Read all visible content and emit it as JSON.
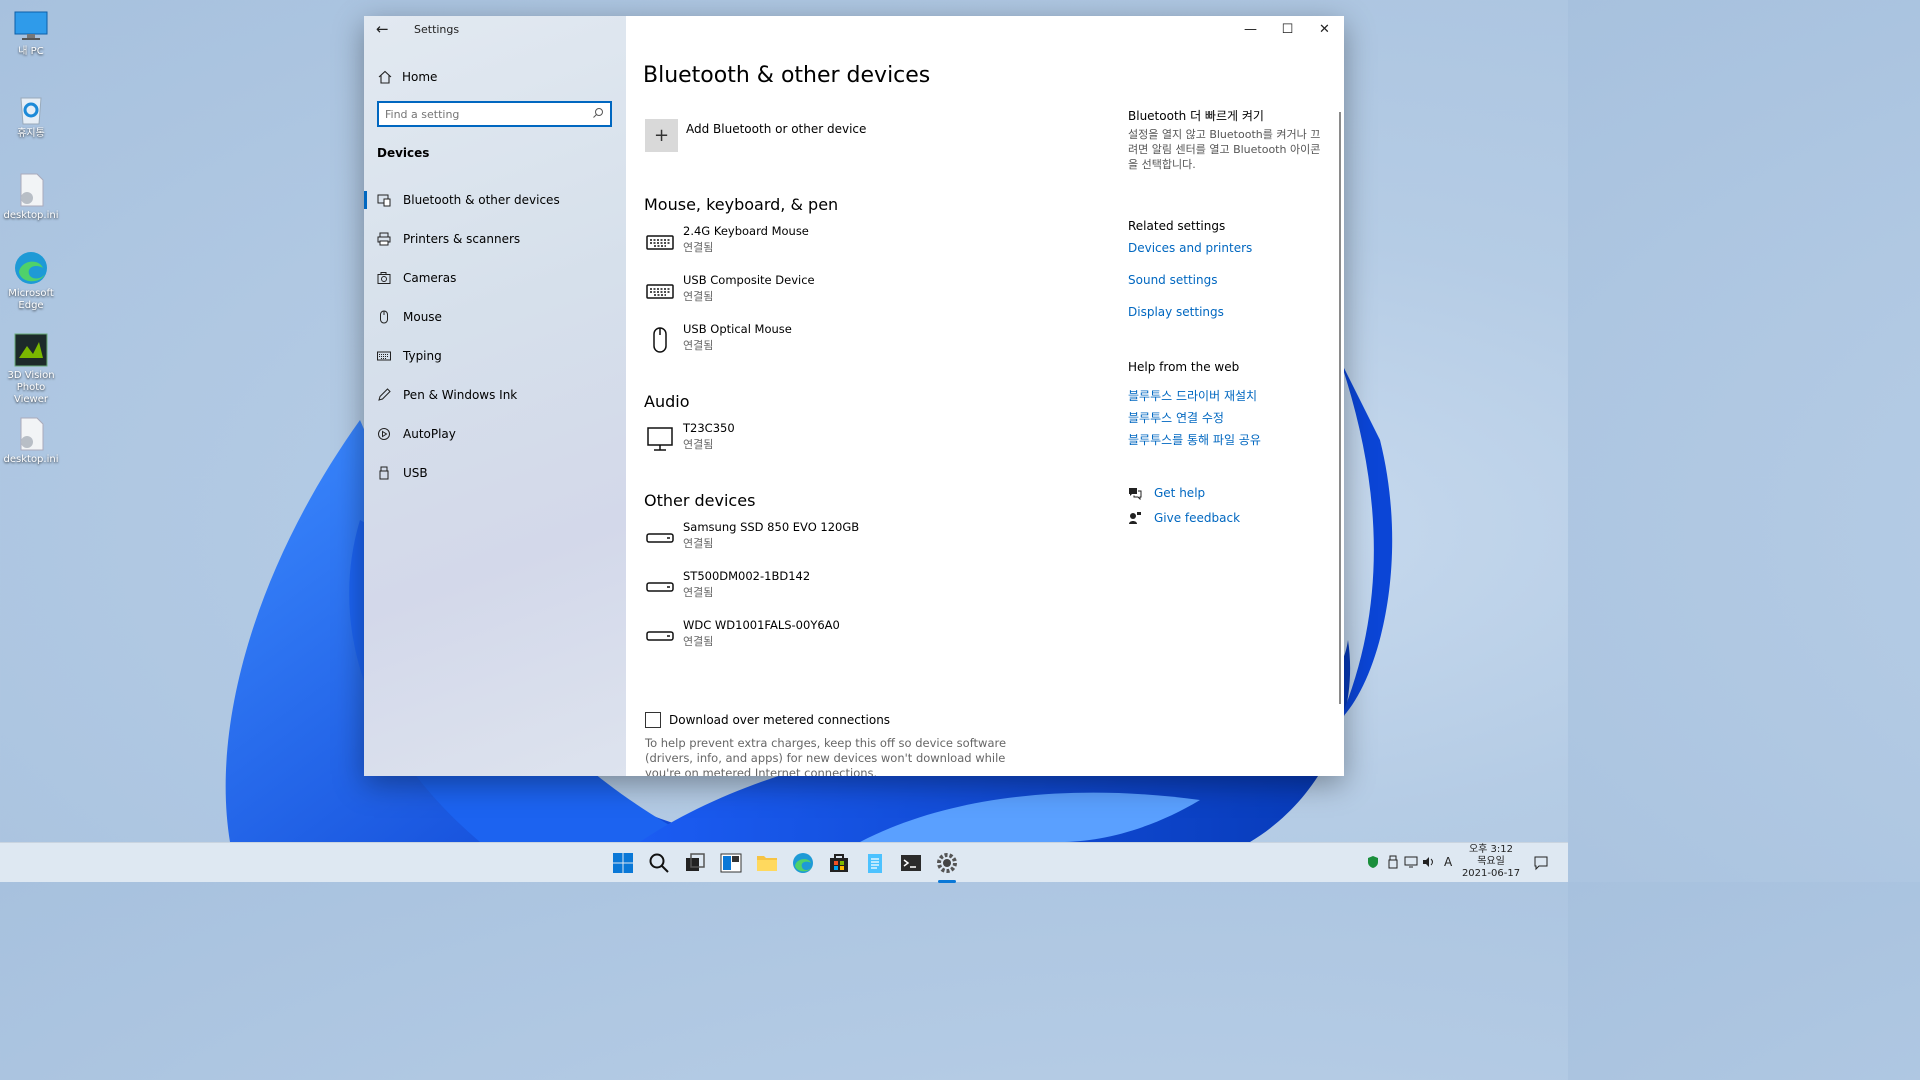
{
  "desktop": {
    "icons": [
      {
        "label": "내 PC",
        "icon": "computer-icon"
      },
      {
        "label": "휴지통",
        "icon": "recycle-bin-icon"
      },
      {
        "label": "desktop.ini",
        "icon": "settings-file-icon"
      },
      {
        "label": "Microsoft Edge",
        "icon": "edge-icon"
      },
      {
        "label": "3D Vision Photo Viewer",
        "icon": "photo-viewer-icon"
      },
      {
        "label": "desktop.ini",
        "icon": "settings-file-icon"
      }
    ]
  },
  "window": {
    "title": "Settings",
    "controls": {
      "minimize": "—",
      "maximize": "☐",
      "close": "✕"
    }
  },
  "nav": {
    "home_label": "Home",
    "search_placeholder": "Find a setting",
    "section_label": "Devices",
    "items": [
      {
        "label": "Bluetooth & other devices",
        "icon": "bluetooth-devices-icon",
        "active": true
      },
      {
        "label": "Printers & scanners",
        "icon": "printer-icon",
        "active": false
      },
      {
        "label": "Cameras",
        "icon": "camera-icon",
        "active": false
      },
      {
        "label": "Mouse",
        "icon": "mouse-icon",
        "active": false
      },
      {
        "label": "Typing",
        "icon": "keyboard-icon",
        "active": false
      },
      {
        "label": "Pen & Windows Ink",
        "icon": "pen-icon",
        "active": false
      },
      {
        "label": "AutoPlay",
        "icon": "autoplay-icon",
        "active": false
      },
      {
        "label": "USB",
        "icon": "usb-icon",
        "active": false
      }
    ]
  },
  "main": {
    "title": "Bluetooth & other devices",
    "add_device_label": "Add Bluetooth or other device",
    "groups": [
      {
        "heading": "Mouse, keyboard, & pen",
        "devices": [
          {
            "name": "2.4G Keyboard Mouse",
            "status": "연결됨",
            "icon": "keyboard-icon"
          },
          {
            "name": "USB Composite Device",
            "status": "연결됨",
            "icon": "keyboard-icon"
          },
          {
            "name": "USB Optical Mouse",
            "status": "연결됨",
            "icon": "mouse-icon"
          }
        ]
      },
      {
        "heading": "Audio",
        "devices": [
          {
            "name": "T23C350",
            "status": "연결됨",
            "icon": "monitor-icon"
          }
        ]
      },
      {
        "heading": "Other devices",
        "devices": [
          {
            "name": "Samsung SSD 850 EVO 120GB",
            "status": "연결됨",
            "icon": "drive-icon"
          },
          {
            "name": "ST500DM002-1BD142",
            "status": "연결됨",
            "icon": "drive-icon"
          },
          {
            "name": "WDC WD1001FALS-00Y6A0",
            "status": "연결됨",
            "icon": "drive-icon"
          }
        ]
      }
    ],
    "metered_label": "Download over metered connections",
    "metered_checked": false,
    "metered_help": "To help prevent extra charges, keep this off so device software (drivers, info, and apps) for new devices won't download while you're on metered Internet connections."
  },
  "sidebar": {
    "quick_heading": "Bluetooth 더 빠르게 켜기",
    "quick_text": "설정을 열지 않고 Bluetooth를 켜거나 끄려면 알림 센터를 열고 Bluetooth 아이콘을 선택합니다.",
    "related_heading": "Related settings",
    "related_links": [
      "Devices and printers",
      "Sound settings",
      "Display settings"
    ],
    "web_heading": "Help from the web",
    "web_links": [
      "블루투스 드라이버 재설치",
      "블루투스 연결 수정",
      "블루투스를 통해 파일 공유"
    ],
    "get_help": "Get help",
    "give_feedback": "Give feedback"
  },
  "taskbar": {
    "apps": [
      "start-icon",
      "search-icon",
      "task-view-icon",
      "widgets-icon",
      "file-explorer-icon",
      "edge-icon",
      "store-icon",
      "notepad-icon",
      "terminal-icon",
      "settings-icon"
    ],
    "tray": {
      "ime": "A"
    },
    "clock": {
      "time": "오후 3:12",
      "day": "목요일",
      "date": "2021-06-17"
    }
  },
  "colors": {
    "accent": "#0067c0",
    "link": "#0067c0"
  }
}
